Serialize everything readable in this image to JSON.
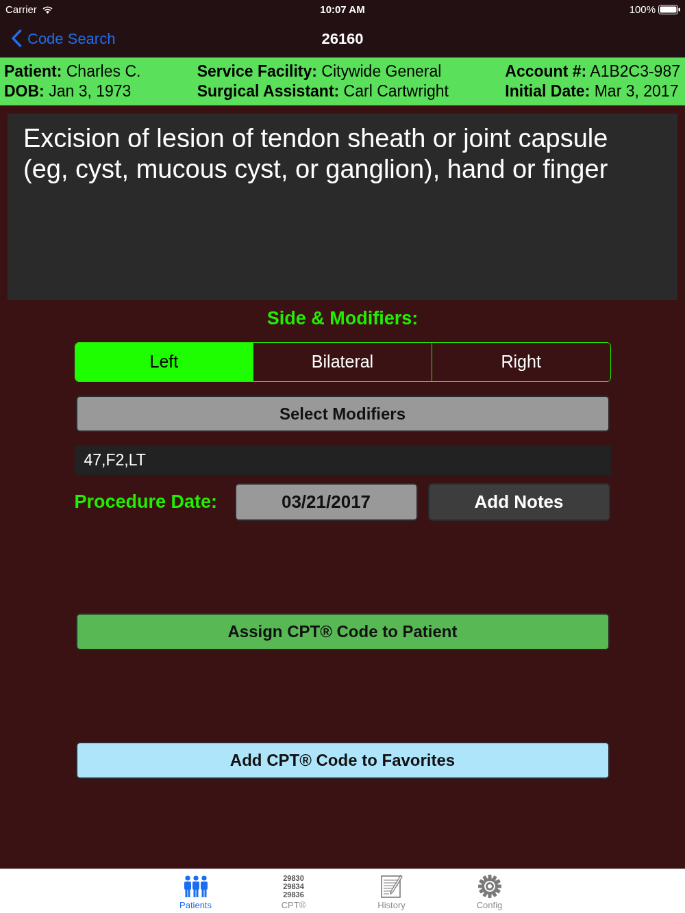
{
  "status_bar": {
    "carrier": "Carrier",
    "time": "10:07 AM",
    "battery": "100%"
  },
  "nav_bar": {
    "back_label": "Code Search",
    "title": "26160"
  },
  "patient_header": {
    "columns": [
      [
        "**Patient:** Charles C.",
        "**DOB:** Jan 3, 1973"
      ],
      [
        "**Service Facility:** Citywide General",
        "**Surgical Assistant:** Carl Cartwright"
      ],
      [
        "**Account #:** A1B2C3-987",
        "**Initial Date:** Mar 3, 2017"
      ]
    ]
  },
  "description": "Excision of lesion of tendon sheath or joint capsule (eg, cyst, mucous cyst, or ganglion), hand or finger",
  "side_modifiers": {
    "title": "Side & Modifiers:",
    "sides": [
      {
        "label": "Left",
        "selected": true
      },
      {
        "label": "Bilateral",
        "selected": false
      },
      {
        "label": "Right",
        "selected": false
      }
    ],
    "select_button": "Select Modifiers",
    "modifiers_value": "47,F2,LT"
  },
  "procedure_date": {
    "label": "Procedure Date:",
    "date": "03/21/2017",
    "notes_button": "Add Notes"
  },
  "actions": [
    {
      "label": "Assign CPT® Code to Patient",
      "kind": "assign"
    },
    {
      "label": "Add CPT® Code to Favorites",
      "kind": "favorite"
    }
  ],
  "tab_bar": {
    "items": [
      {
        "label": "Patients",
        "kind": "people",
        "selected": true
      },
      {
        "label": "CPT®",
        "kind": "codes",
        "codes": [
          "29830",
          "29834",
          "29836"
        ],
        "selected": false
      },
      {
        "label": "History",
        "kind": "notepad",
        "selected": false
      },
      {
        "label": "Config",
        "kind": "gear",
        "selected": false
      }
    ]
  }
}
